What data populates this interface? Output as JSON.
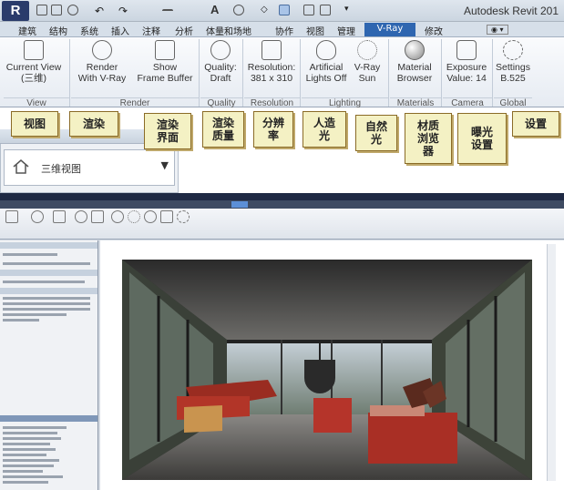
{
  "app": {
    "logo": "R",
    "title": "Autodesk Revit 201"
  },
  "qat": {
    "letter_a": "A"
  },
  "tabs": [
    "建筑",
    "结构",
    "系统",
    "插入",
    "注释",
    "分析",
    "体量和场地",
    "协作",
    "视图",
    "管理",
    "V-Ray",
    "修改"
  ],
  "active_tab": "V-Ray",
  "ribbon": {
    "buttons": [
      {
        "id": "current-view",
        "line1": "Current View",
        "line2": "(三维)",
        "icon": "view-cube-icon"
      },
      {
        "id": "render",
        "line1": "Render",
        "line2": "With V-Ray",
        "icon": "teapot-icon"
      },
      {
        "id": "frame-buffer",
        "line1": "Show",
        "line2": "Frame Buffer",
        "icon": "frame-buffer-icon"
      },
      {
        "id": "quality",
        "line1": "Quality:",
        "line2": "Draft",
        "icon": "quality-icon"
      },
      {
        "id": "resolution",
        "line1": "Resolution:",
        "line2": "381 x 310",
        "icon": "resolution-icon"
      },
      {
        "id": "artificial-lights",
        "line1": "Artificial",
        "line2": "Lights Off",
        "icon": "bulb-icon"
      },
      {
        "id": "vray-sun",
        "line1": "V-Ray",
        "line2": "Sun",
        "icon": "sun-icon"
      },
      {
        "id": "material-browser",
        "line1": "Material",
        "line2": "Browser",
        "icon": "material-sphere-icon"
      },
      {
        "id": "exposure",
        "line1": "Exposure",
        "line2": "Value: 14",
        "icon": "camera-icon"
      },
      {
        "id": "settings",
        "line1": "Settings",
        "line2": "B.525",
        "icon": "gear-icon"
      }
    ],
    "groups": [
      "View",
      "Render",
      "Quality",
      "Resolution",
      "Lighting",
      "Materials",
      "Camera",
      "Global"
    ]
  },
  "callouts": [
    {
      "id": "view",
      "text": "视图"
    },
    {
      "id": "render",
      "text": "渲染"
    },
    {
      "id": "frame-buffer",
      "text": "渲染\n界面"
    },
    {
      "id": "quality",
      "text": "渲染\n质量"
    },
    {
      "id": "resolution",
      "text": "分辨\n率"
    },
    {
      "id": "artificial",
      "text": "人造\n光"
    },
    {
      "id": "natural",
      "text": "自然\n光"
    },
    {
      "id": "material",
      "text": "材质\n浏览\n器"
    },
    {
      "id": "exposure",
      "text": "曝光\n设置"
    },
    {
      "id": "settings",
      "text": "设置"
    }
  ],
  "view_selector": {
    "label": "三维视图",
    "icon": "house-icon"
  },
  "colors": {
    "accent": "#2f66b0",
    "callout_bg": "#f4f1c4",
    "callout_border": "#8a6b27"
  }
}
